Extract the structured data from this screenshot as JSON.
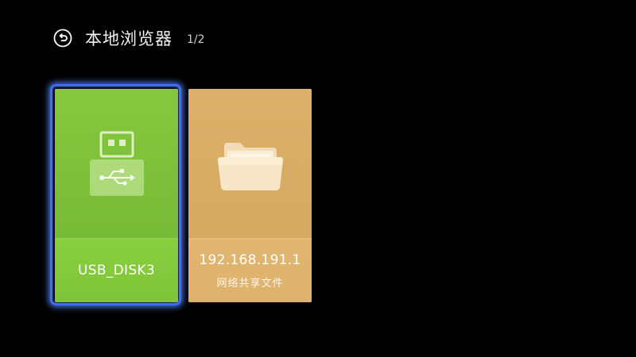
{
  "header": {
    "back_icon": "back-arrow-circle-icon",
    "title": "本地浏览器",
    "page_counter": "1/2"
  },
  "tiles": [
    {
      "icon": "usb-drive-icon",
      "label": "USB_DISK3",
      "focused": true,
      "color": "#7ec13a"
    },
    {
      "icon": "folder-icon",
      "label": "192.168.191.1",
      "sublabel": "网络共享文件",
      "focused": false,
      "color": "#d9ad66"
    }
  ],
  "colors": {
    "background": "#000000",
    "focus_ring": "#3f6dff"
  }
}
